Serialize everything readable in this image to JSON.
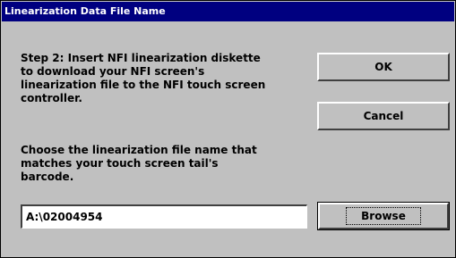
{
  "window": {
    "title": "Linearization Data File Name"
  },
  "instructions": {
    "step": "Step 2:  Insert NFI linearization diskette\nto download your NFI screen's\nlinearization file to the NFI touch screen\ncontroller.",
    "choose": "Choose the linearization file name that\nmatches your touch screen tail's\nbarcode."
  },
  "buttons": {
    "ok_label": "OK",
    "cancel_label": "Cancel",
    "browse_label": "Browse"
  },
  "file_name": {
    "value": "A:\\02004954"
  },
  "colors": {
    "title_bar": "#000080",
    "dialog_face": "#c0c0c0",
    "input_background": "#ffffff"
  }
}
